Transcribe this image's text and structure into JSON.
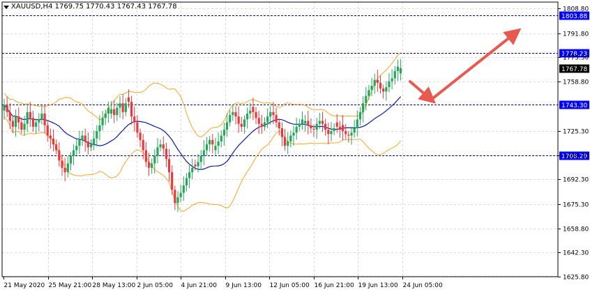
{
  "header": {
    "symbol": "XAUUSD,H4",
    "ohlc": "1769.75 1770.43 1767.43 1767.78"
  },
  "colors": {
    "background": "#ffffff",
    "grid": "#d9d9d9",
    "bull_candle": "#26a65b",
    "bear_candle": "#e8393c",
    "bollinger": "#f5a623",
    "moving_average": "#0a1aa0",
    "level_line": "#00008b",
    "level_label_bg": "#0000ff",
    "current_price_bg": "#000000",
    "arrow": "#e85a4f"
  },
  "chart_data": {
    "type": "candlestick",
    "ylim": [
      1625.8,
      1813.0
    ],
    "y_ticks": [
      "1808.80",
      "1791.80",
      "1775.30",
      "1758.80",
      "1725.30",
      "1708.30",
      "1692.30",
      "1675.30",
      "1658.80",
      "1642.30",
      "1625.80"
    ],
    "x_ticks": [
      "21 May 2020",
      "25 May 21:00",
      "28 May 13:00",
      "2 Jun 05:00",
      "4 Jun 21:00",
      "9 Jun 13:00",
      "12 Jun 05:00",
      "16 Jun 21:00",
      "19 Jun 13:00",
      "24 Jun 05:00"
    ],
    "levels": [
      {
        "value": 1803.88,
        "label": "1803.88"
      },
      {
        "value": 1778.23,
        "label": "1778.23"
      },
      {
        "value": 1743.3,
        "label": "1743.30"
      },
      {
        "value": 1708.29,
        "label": "1708.29"
      }
    ],
    "current_price": {
      "value": 1767.78,
      "label": "1767.78"
    },
    "close_path": [
      1743,
      1738,
      1732,
      1728,
      1735,
      1731,
      1726,
      1730,
      1738,
      1734,
      1728,
      1731,
      1733,
      1737,
      1729,
      1722,
      1720,
      1716,
      1712,
      1705,
      1700,
      1697,
      1703,
      1708,
      1712,
      1715,
      1719,
      1722,
      1718,
      1714,
      1716,
      1720,
      1725,
      1729,
      1734,
      1737,
      1741,
      1740,
      1736,
      1741,
      1744,
      1738,
      1744,
      1745,
      1735,
      1731,
      1724,
      1719,
      1712,
      1704,
      1700,
      1703,
      1708,
      1714,
      1716,
      1713,
      1706,
      1697,
      1685,
      1676,
      1680,
      1683,
      1688,
      1693,
      1697,
      1700,
      1701,
      1704,
      1708,
      1712,
      1716,
      1719,
      1716,
      1715,
      1718,
      1722,
      1726,
      1731,
      1736,
      1738,
      1735,
      1730,
      1728,
      1733,
      1737,
      1739,
      1738,
      1734,
      1730,
      1728,
      1731,
      1735,
      1738,
      1736,
      1731,
      1727,
      1721,
      1715,
      1718,
      1722,
      1724,
      1728,
      1730,
      1733,
      1732,
      1729,
      1727,
      1726,
      1730,
      1732,
      1730,
      1726,
      1723,
      1725,
      1727,
      1728,
      1726,
      1725,
      1723,
      1722,
      1724,
      1727,
      1733,
      1738,
      1744,
      1749,
      1753,
      1756,
      1760,
      1758,
      1754,
      1752,
      1755,
      1759,
      1761,
      1766,
      1769,
      1768
    ]
  }
}
